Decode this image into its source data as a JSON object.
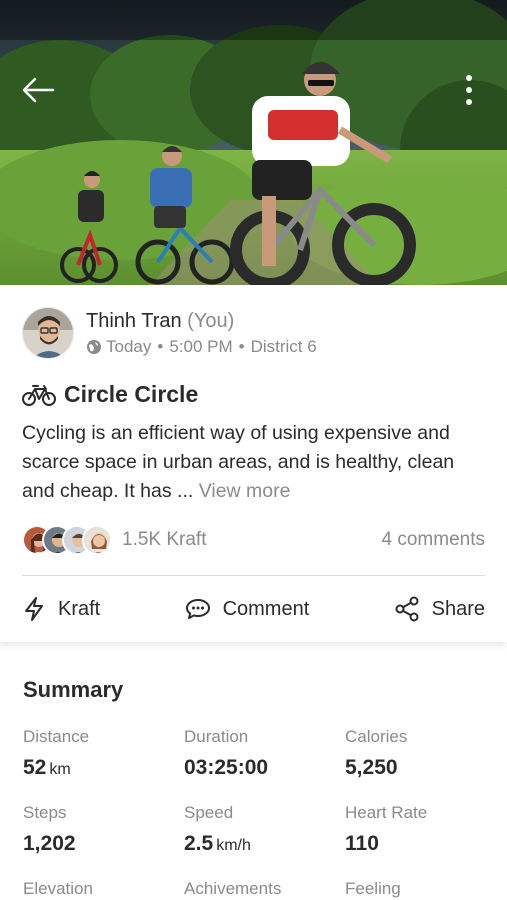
{
  "hero": {
    "back_icon": "arrow-left-icon",
    "more_icon": "more-vertical-icon"
  },
  "post": {
    "author": {
      "name": "Thinh Tran",
      "you_tag": "(You)"
    },
    "meta": {
      "globe_icon": "globe-icon",
      "time": "Today",
      "clock": "5:00 PM",
      "location": "District 6",
      "separator": "•"
    },
    "activity_icon": "bicycle-icon",
    "title": "Circle Circle",
    "description": "Cycling is an efficient way of using expensive and scarce space in urban areas, and is healthy, clean and cheap. It has ...",
    "view_more": "View more",
    "kraft_count": "1.5K Kraft",
    "comments_count": "4 comments",
    "actions": {
      "kraft": "Kraft",
      "comment": "Comment",
      "share": "Share"
    }
  },
  "summary": {
    "title": "Summary",
    "metrics": [
      {
        "label": "Distance",
        "value": "52",
        "unit": "km"
      },
      {
        "label": "Duration",
        "value": "03:25:00",
        "unit": ""
      },
      {
        "label": "Calories",
        "value": "5,250",
        "unit": ""
      },
      {
        "label": "Steps",
        "value": "1,202",
        "unit": ""
      },
      {
        "label": "Speed",
        "value": "2.5",
        "unit": "km/h"
      },
      {
        "label": "Heart Rate",
        "value": "110",
        "unit": ""
      },
      {
        "label": "Elevation",
        "value": "",
        "unit": ""
      },
      {
        "label": "Achivements",
        "value": "",
        "unit": ""
      },
      {
        "label": "Feeling",
        "value": "",
        "unit": ""
      }
    ]
  },
  "colors": {
    "text_primary": "#2b2b2b",
    "text_secondary": "#8a8a8a",
    "divider": "#dcdcdc"
  }
}
